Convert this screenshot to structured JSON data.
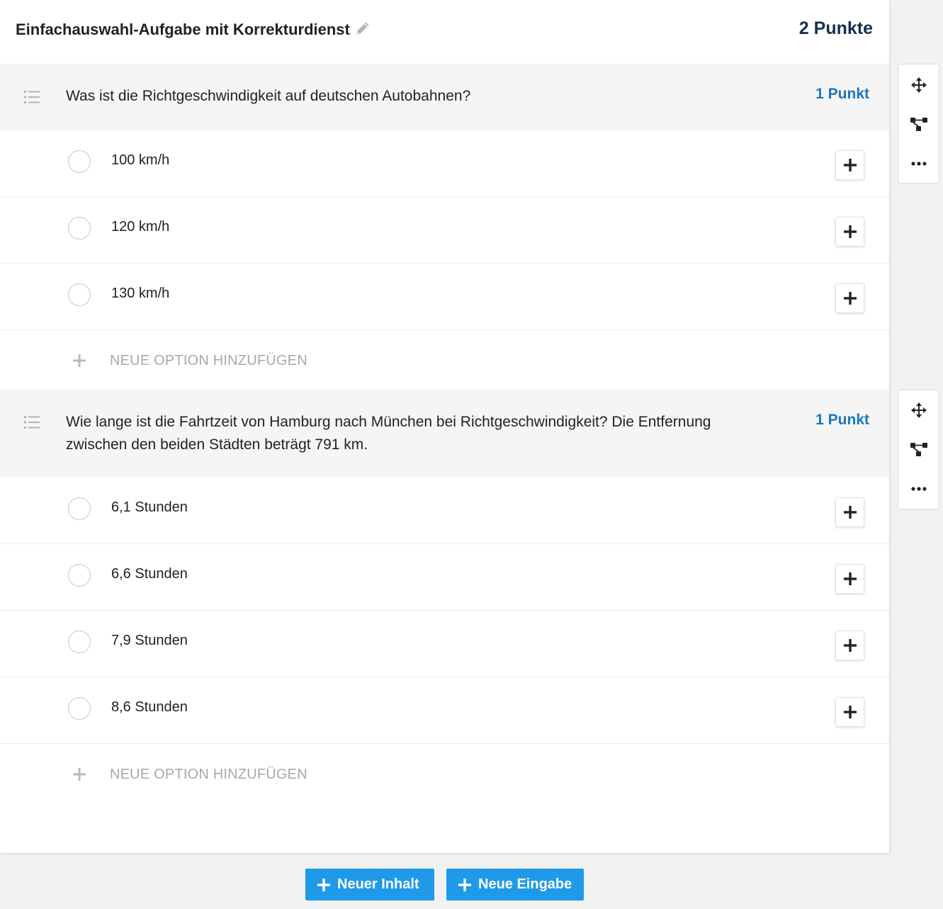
{
  "header": {
    "title": "Einfachauswahl-Aufgabe mit Korrekturdienst",
    "points": "2 Punkte"
  },
  "questions": [
    {
      "text": "Was ist die Richtgeschwindigkeit auf deutschen Autobahnen?",
      "points": "1 Punkt",
      "options": [
        "100 km/h",
        "120 km/h",
        "130 km/h"
      ],
      "add_option_label": "NEUE OPTION HINZUFÜGEN"
    },
    {
      "text": "Wie lange ist die Fahrtzeit von Hamburg nach München bei Richtgeschwindigkeit? Die Entfernung zwischen den beiden Städten beträgt 791 km.",
      "points": "1 Punkt",
      "options": [
        "6,1 Stunden",
        "6,6 Stunden",
        "7,9 Stunden",
        "8,6 Stunden"
      ],
      "add_option_label": "NEUE OPTION HINZUFÜGEN"
    }
  ],
  "icons": {
    "edit": "pencil-icon",
    "drag": "list-handle-icon",
    "option_add": "plus-icon",
    "move": "move-arrows-icon",
    "branch": "branch-icon",
    "more": "more-dots-icon"
  },
  "footer": {
    "new_content_label": "Neuer Inhalt",
    "new_input_label": "Neue Eingabe"
  },
  "colors": {
    "accent": "#1e9ae8",
    "points_blue": "#1a76bd",
    "title_navy": "#14304e"
  }
}
